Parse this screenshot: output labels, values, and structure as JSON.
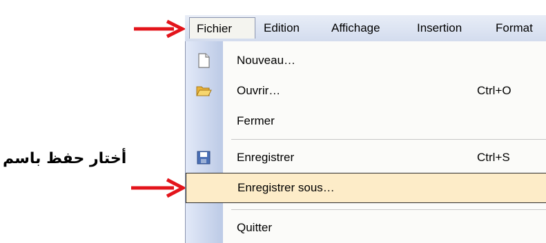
{
  "menubar": {
    "items": [
      {
        "label": "Fichier",
        "active": true
      },
      {
        "label": "Edition"
      },
      {
        "label": "Affichage"
      },
      {
        "label": "Insertion"
      },
      {
        "label": "Format"
      }
    ]
  },
  "menu": {
    "items": [
      {
        "label": "Nouveau…",
        "shortcut": "",
        "icon": "new-document-icon"
      },
      {
        "label": "Ouvrir…",
        "shortcut": "Ctrl+O",
        "icon": "open-folder-icon"
      },
      {
        "label": "Fermer",
        "shortcut": "",
        "icon": ""
      },
      {
        "label": "Enregistrer",
        "shortcut": "Ctrl+S",
        "icon": "save-disk-icon"
      },
      {
        "label": "Enregistrer sous…",
        "shortcut": "",
        "icon": "",
        "highlighted": true
      },
      {
        "label": "Quitter",
        "shortcut": "",
        "icon": ""
      }
    ]
  },
  "annotation": {
    "text": "أختار حفظ باسم",
    "arrow_color": "#e3141b"
  },
  "colors": {
    "menu_highlight": "#fdecc8",
    "icon_column": "#c9d5ef",
    "menubar": "#dde4f2"
  }
}
